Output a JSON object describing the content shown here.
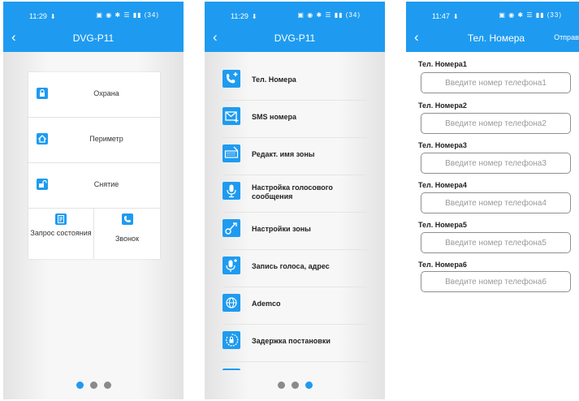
{
  "screen1": {
    "status": {
      "time": "11:29",
      "download_icon": "download-arrow-icon",
      "battery": "34"
    },
    "header": {
      "back": "‹",
      "title": "DVG-P11"
    },
    "buttons": [
      {
        "label": "Охрана",
        "icon": "lock-icon"
      },
      {
        "label": "Периметр",
        "icon": "home-icon"
      },
      {
        "label": "Снятие",
        "icon": "unlock-icon"
      }
    ],
    "bottom": [
      {
        "label": "Запрос состояния",
        "icon": "status-query-icon"
      },
      {
        "label": "Звонок",
        "icon": "phone-call-icon"
      }
    ],
    "active_page": 1
  },
  "screen2": {
    "status": {
      "time": "11:29",
      "battery": "34"
    },
    "header": {
      "back": "‹",
      "title": "DVG-P11"
    },
    "menu": [
      {
        "label": "Тел. Номера",
        "icon": "phone-add-icon"
      },
      {
        "label": "SMS номера",
        "icon": "sms-add-icon"
      },
      {
        "label": "Редакт. имя зоны",
        "icon": "keyboard-icon"
      },
      {
        "label": "Настройка голосового сообщения",
        "icon": "microphone-icon"
      },
      {
        "label": "Настройки зоны",
        "icon": "zone-settings-icon"
      },
      {
        "label": "Запись голоса, адрес",
        "icon": "record-voice-icon"
      },
      {
        "label": "Ademco",
        "icon": "globe-icon"
      },
      {
        "label": "Задержка постановки",
        "icon": "arm-delay-icon"
      }
    ],
    "active_page": 3
  },
  "screen3": {
    "status": {
      "time": "11:47",
      "battery": "33"
    },
    "header": {
      "back": "‹",
      "title": "Тел. Номера",
      "send": "Отправка"
    },
    "fields": [
      {
        "label": "Тел. Номера1",
        "placeholder": "Введите номер телефона1"
      },
      {
        "label": "Тел. Номера2",
        "placeholder": "Введите номер телефона2"
      },
      {
        "label": "Тел. Номера3",
        "placeholder": "Введите номер телефона3"
      },
      {
        "label": "Тел. Номера4",
        "placeholder": "Введите номер телефона4"
      },
      {
        "label": "Тел. Номера5",
        "placeholder": "Введите номер телефона5"
      },
      {
        "label": "Тел. Номера6",
        "placeholder": "Введите номер телефона6"
      }
    ]
  },
  "colors": {
    "accent": "#1e9bf0",
    "dot_inactive": "#8a8a8a"
  }
}
